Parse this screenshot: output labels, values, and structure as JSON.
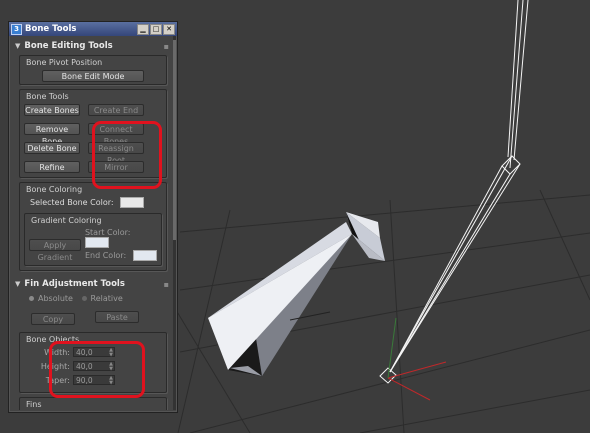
{
  "window": {
    "app_icon": "3",
    "title": "Bone Tools",
    "buttons": [
      "▁",
      "□",
      "✕"
    ]
  },
  "bone_editing": {
    "header": "Bone Editing Tools",
    "pivot_group": "Bone Pivot Position",
    "bone_edit_mode": "Bone Edit Mode",
    "tools_group": "Bone Tools",
    "create_bones": "Create Bones",
    "create_end": "Create End",
    "remove_bone": "Remove Bone",
    "connect_bones": "Connect Bones",
    "delete_bone": "Delete Bone",
    "reassign_root": "Reassign Root",
    "refine": "Refine",
    "mirror": "Mirror",
    "coloring_group": "Bone Coloring",
    "selected_bone_color": "Selected Bone Color:",
    "gradient_group": "Gradient Coloring",
    "apply_gradient": "Apply Gradient",
    "start_color": "Start Color:",
    "end_color": "End Color:"
  },
  "fin_adjustment": {
    "header": "Fin Adjustment Tools",
    "absolute": "Absolute",
    "relative": "Relative",
    "copy": "Copy",
    "paste": "Paste",
    "bone_objects": "Bone Objects",
    "width_label": "Width:",
    "width_value": "40,0",
    "height_label": "Height:",
    "height_value": "40,0",
    "taper_label": "Taper:",
    "taper_value": "90,0",
    "fins_group": "Fins"
  },
  "colors": {
    "viewport_bg": "#3c3c3c",
    "highlight": "#e0121e",
    "bone_fill": "#c8ccd6",
    "bone_dark": "#111111",
    "wire": "#ffffff",
    "axis_red": "#c0282a"
  }
}
